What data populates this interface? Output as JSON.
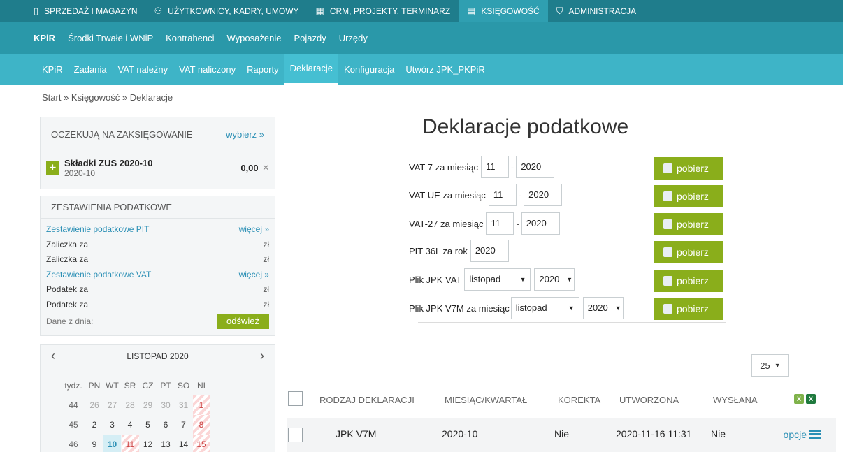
{
  "topnav": {
    "items": [
      {
        "label": "SPRZEDAŻ I MAGAZYN",
        "icon": "book-icon"
      },
      {
        "label": "UŻYTKOWNICY, KADRY, UMOWY",
        "icon": "users-icon"
      },
      {
        "label": "CRM, PROJEKTY, TERMINARZ",
        "icon": "calendar-icon"
      },
      {
        "label": "KSIĘGOWOŚĆ",
        "icon": "ledger-icon"
      },
      {
        "label": "ADMINISTRACJA",
        "icon": "shield-icon"
      }
    ]
  },
  "subnav1": {
    "items": [
      "KPiR",
      "Środki Trwałe i WNiP",
      "Kontrahenci",
      "Wyposażenie",
      "Pojazdy",
      "Urzędy"
    ]
  },
  "subnav2": {
    "items": [
      "KPiR",
      "Zadania",
      "VAT należny",
      "VAT naliczony",
      "Raporty",
      "Deklaracje",
      "Konfiguracja",
      "Utwórz JPK_PKPiR"
    ]
  },
  "breadcrumb": "Start » Księgowość » Deklaracje",
  "pending": {
    "title": "OCZEKUJĄ NA ZAKSIĘGOWANIE",
    "choose": "wybierz »",
    "item": {
      "title": "Składki ZUS 2020-10",
      "date": "2020-10",
      "amount": "0,00",
      "close": "×",
      "plus": "+"
    }
  },
  "taxsum": {
    "title": "ZESTAWIENIA PODATKOWE",
    "rows": [
      {
        "label": "Zestawienie podatkowe PIT",
        "value": "więcej »"
      },
      {
        "label": "Zaliczka za",
        "value": "zł"
      },
      {
        "label": "Zaliczka za",
        "value": "zł"
      },
      {
        "label": "Zestawienie podatkowe VAT",
        "value": "więcej »"
      },
      {
        "label": "Podatek za",
        "value": "zł"
      },
      {
        "label": "Podatek za",
        "value": "zł"
      }
    ],
    "date_label": "Dane z dnia:",
    "refresh": "odśwież"
  },
  "calendar": {
    "title": "LISTOPAD 2020",
    "prev": "‹",
    "next": "›",
    "headers": [
      "tydz.",
      "PN",
      "WT",
      "ŚR",
      "CZ",
      "PT",
      "SO",
      "NI"
    ],
    "weeks": [
      [
        "44",
        "26",
        "27",
        "28",
        "29",
        "30",
        "31",
        "1"
      ],
      [
        "45",
        "2",
        "3",
        "4",
        "5",
        "6",
        "7",
        "8"
      ],
      [
        "46",
        "9",
        "10",
        "11",
        "12",
        "13",
        "14",
        "15"
      ]
    ]
  },
  "main": {
    "title": "Deklaracje podatkowe",
    "declarations": [
      {
        "label": "VAT 7 za miesiąc",
        "month": "11",
        "year": "2020",
        "button": "pobierz"
      },
      {
        "label": "VAT UE za miesiąc",
        "month": "11",
        "year": "2020",
        "button": "pobierz"
      },
      {
        "label": "VAT-27 za miesiąc",
        "month": "11",
        "year": "2020",
        "button": "pobierz"
      },
      {
        "label": "PIT 36L za rok",
        "year": "2020",
        "button": "pobierz"
      },
      {
        "label": "Plik JPK VAT",
        "month": "listopad",
        "year": "2020",
        "button": "pobierz"
      },
      {
        "label": "Plik JPK V7M za miesiąc",
        "month": "listopad",
        "year": "2020",
        "button": "pobierz"
      }
    ],
    "page_size": "25"
  },
  "table": {
    "headers": [
      "RODZAJ DEKLARACJI",
      "MIESIĄC/KWARTAŁ",
      "KOREKTA",
      "UTWORZONA",
      "WYSŁANA"
    ],
    "rows": [
      {
        "type": "JPK V7M",
        "period": "2020-10",
        "correction": "Nie",
        "created": "2020-11-16 11:31",
        "sent": "Nie",
        "options": "opcje"
      }
    ]
  }
}
